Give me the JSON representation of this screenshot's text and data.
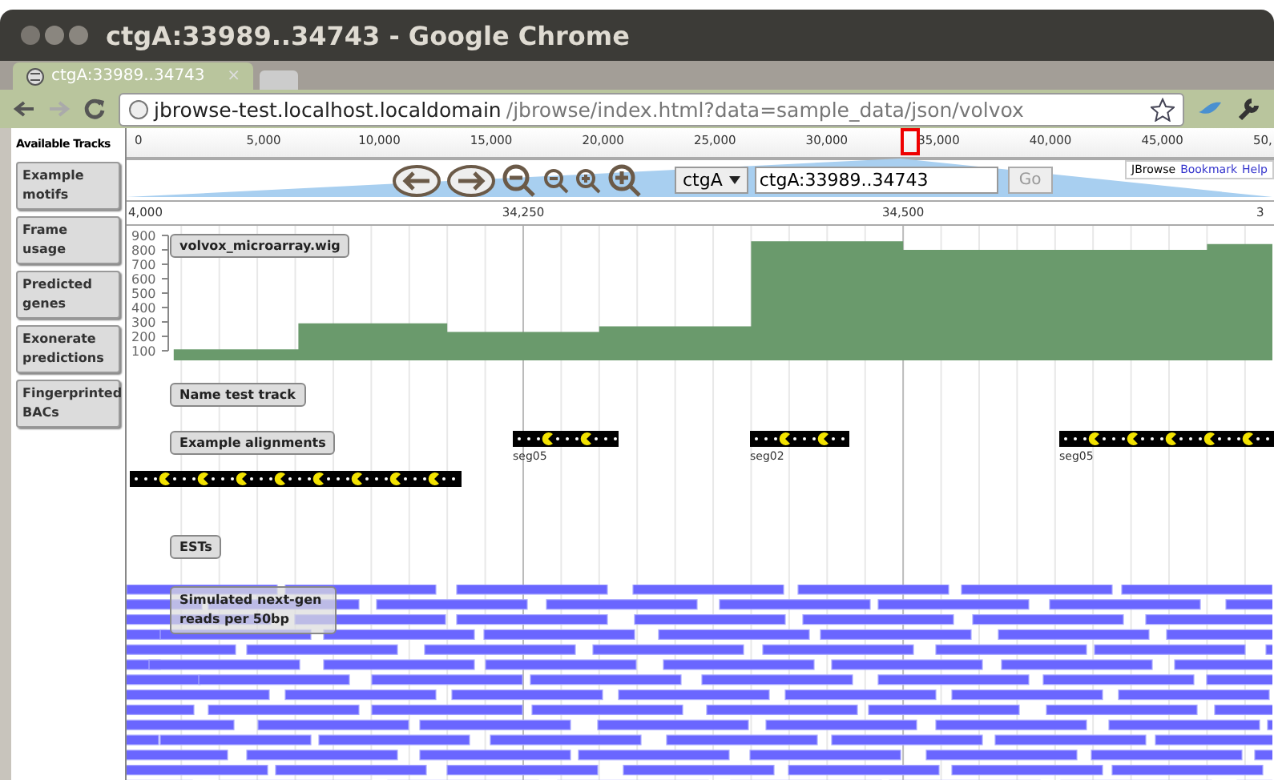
{
  "window": {
    "title": "ctgA:33989..34743 - Google Chrome"
  },
  "tabs": [
    {
      "label": "ctgA:33989..34743",
      "close": "×",
      "selected": true
    }
  ],
  "address_bar": {
    "host": "jbrowse-test.localhost.localdomain",
    "path": "/jbrowse/index.html?data=sample_data/json/volvox"
  },
  "sidebar": {
    "title": "Available Tracks",
    "items": [
      "Example motifs",
      "Frame usage",
      "Predicted genes",
      "Exonerate predictions",
      "Fingerprinted BACs"
    ]
  },
  "overview_ruler": [
    "0",
    "5,000",
    "10,000",
    "15,000",
    "20,000",
    "25,000",
    "30,000",
    "35,000",
    "40,000",
    "45,000",
    "50,"
  ],
  "navigation": {
    "chrom": "ctgA",
    "location": "ctgA:33989..34743",
    "go": "Go"
  },
  "header_links": {
    "brand": "JBrowse",
    "links": [
      "Bookmark",
      "Help"
    ]
  },
  "detail_ruler": [
    "4,000",
    "34,250",
    "34,500",
    "3"
  ],
  "tracks": {
    "wig": {
      "label": "volvox_microarray.wig",
      "y_axis_labels": [
        "900",
        "800",
        "700",
        "600",
        "500",
        "400",
        "300",
        "200",
        "100"
      ]
    },
    "labels": [
      "Name test track",
      "Example alignments",
      "ESTs",
      "Simulated next-gen reads per 50bp"
    ],
    "features": [
      {
        "label": "seg05"
      },
      {
        "label": "seg02"
      },
      {
        "label": "seg05"
      }
    ]
  }
}
